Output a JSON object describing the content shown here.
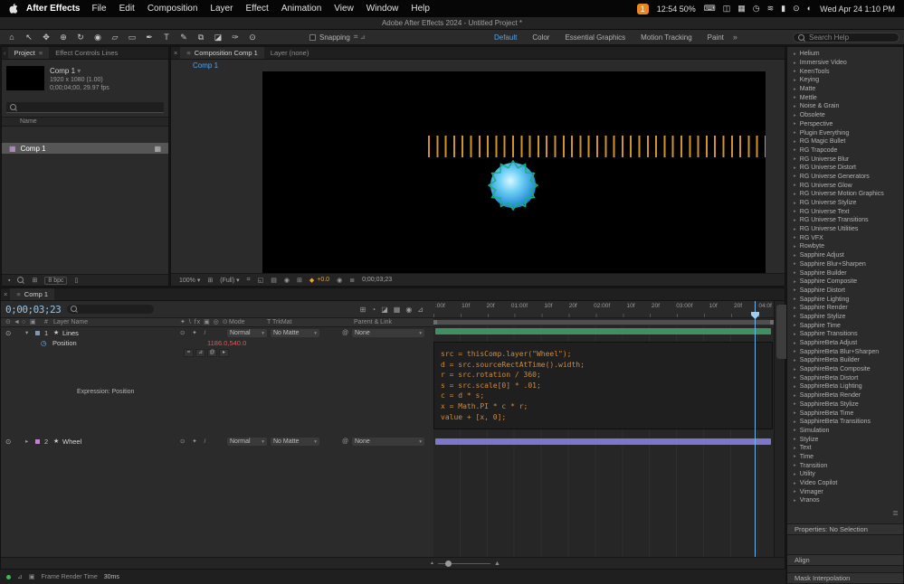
{
  "icons": {
    "menu": "≡",
    "hamburger": "≣",
    "close": "×",
    "chevron_left": "‹",
    "chevron_down": "▾",
    "chevron_exp": "▸",
    "twirl_open": "▾",
    "star": "★",
    "eye": "⊙",
    "audio": "◄",
    "solo": "○",
    "lock": "▣",
    "stopwatch": "◷",
    "pickwhip": "@",
    "comp": "▦",
    "grid": "⊞",
    "safe_margins": "⌗",
    "mask": "◱",
    "ruler": "▤",
    "camera": "◉",
    "diamond": "◆",
    "more": "»",
    "equals": "=",
    "graph": "⊿",
    "trash": "▯",
    "folder": "▪",
    "gear": "⚙"
  },
  "menubar": {
    "app_name": "After Effects",
    "menus": [
      "File",
      "Edit",
      "Composition",
      "Layer",
      "Effect",
      "Animation",
      "View",
      "Window",
      "Help"
    ],
    "notification_badge": "1",
    "battery_status": "12:54 50%",
    "status_icons": [
      {
        "name": "keyboard-icon",
        "glyph": "⌨"
      },
      {
        "name": "display-icon",
        "glyph": "◫"
      },
      {
        "name": "grid-icon",
        "glyph": "▦"
      },
      {
        "name": "clock-icon",
        "glyph": "◷"
      },
      {
        "name": "wifi-icon",
        "glyph": "≋"
      },
      {
        "name": "battery-icon",
        "glyph": "▮"
      },
      {
        "name": "spotlight-icon",
        "glyph": "⊙"
      },
      {
        "name": "control-center-icon",
        "glyph": "◐"
      }
    ],
    "clock": "Wed Apr 24 1:10 PM"
  },
  "titlebar": {
    "title": "Adobe After Effects 2024 - Untitled Project *"
  },
  "toolbar": {
    "tools": [
      {
        "name": "home-icon",
        "glyph": "⌂"
      },
      {
        "name": "selection-tool-icon",
        "glyph": "↖"
      },
      {
        "name": "hand-tool-icon",
        "glyph": "✥"
      },
      {
        "name": "zoom-tool-icon",
        "glyph": "⊕"
      },
      {
        "name": "orbit-camera-tool-icon",
        "glyph": "↻"
      },
      {
        "name": "camera-tool-icon",
        "glyph": "◉"
      },
      {
        "name": "pan-behind-tool-icon",
        "glyph": "▱"
      },
      {
        "name": "shape-tool-icon",
        "glyph": "▭"
      },
      {
        "name": "pen-tool-icon",
        "glyph": "✒"
      },
      {
        "name": "type-tool-icon",
        "glyph": "T"
      },
      {
        "name": "brush-tool-icon",
        "glyph": "✎"
      },
      {
        "name": "clone-stamp-tool-icon",
        "glyph": "⧉"
      },
      {
        "name": "eraser-tool-icon",
        "glyph": "◪"
      },
      {
        "name": "roto-brush-tool-icon",
        "glyph": "✑"
      },
      {
        "name": "puppet-pin-tool-icon",
        "glyph": "⊙"
      }
    ],
    "snapping_label": "Snapping",
    "snap_glyphs": "⌗⊿",
    "workspaces": [
      "Default",
      "Color",
      "Essential Graphics",
      "Motion Tracking",
      "Paint"
    ],
    "search_placeholder": "Search Help"
  },
  "project": {
    "tabs": [
      "Project",
      "Effect Controls Lines"
    ],
    "comp_name": "Comp 1",
    "comp_size": "1920 x 1080 (1.00)",
    "comp_duration": "0;00;04;00, 29.97 fps",
    "name_column": "Name",
    "items": [
      {
        "label": "Comp 1"
      }
    ],
    "bit_depth": "8 bpc"
  },
  "comp": {
    "tabs": [
      "Composition Comp 1",
      "Layer (none)"
    ],
    "breadcrumb": "Comp 1",
    "zoom": "100%",
    "resolution": "(Full)",
    "exposure": "+0.0",
    "timecode": "0;00;03;23"
  },
  "timeline": {
    "tab": "Comp 1",
    "timecode": "0;00;03;23",
    "toggles": [
      {
        "name": "comp-mini-flowchart-icon",
        "glyph": "⊞"
      },
      {
        "name": "draft-3d-icon",
        "glyph": "◔"
      },
      {
        "name": "shy-icon",
        "glyph": "◪"
      },
      {
        "name": "frame-blending-icon",
        "glyph": "▦"
      },
      {
        "name": "motion-blur-icon",
        "glyph": "◉"
      },
      {
        "name": "graph-editor-icon",
        "glyph": "⊿"
      }
    ],
    "columns": {
      "number": "#",
      "layer_name": "Layer Name",
      "mode": "Mode",
      "trkmat": "T TrkMat",
      "parent": "Parent & Link"
    },
    "switch_icons": "✦ \\ fx ▣ ◎ ⊙",
    "layers": [
      {
        "index": "1",
        "name": "Lines",
        "switches": "⊙ ✦ /",
        "mode": "Normal",
        "trkmat": "No Matte",
        "parent": "None"
      },
      {
        "index": "2",
        "name": "Wheel",
        "switches": "⊙ ✦ /",
        "mode": "Normal",
        "trkmat": "No Matte",
        "parent": "None"
      }
    ],
    "position_label": "Position",
    "position_value": "1186.0,540.0",
    "expression_label": "Expression: Position",
    "expression_code": [
      "src = thisComp.layer(\"Wheel\");",
      "d = src.sourceRectAtTime().width;",
      "r = src.rotation / 360;",
      "s = src.scale[0] * .01;",
      "c = d * s;",
      "x = Math.PI * c * r;",
      "value + [x, 0];"
    ],
    "ruler_labels": [
      ":00f",
      "10f",
      "20f",
      "01:00f",
      "10f",
      "20f",
      "02:00f",
      "10f",
      "20f",
      "03:00f",
      "10f",
      "20f",
      "04:0f"
    ]
  },
  "effects": {
    "categories": [
      "Helium",
      "Immersive Video",
      "KeenTools",
      "Keying",
      "Matte",
      "Mettle",
      "Noise & Grain",
      "Obsolete",
      "Perspective",
      "Plugin Everything",
      "RG Magic Bullet",
      "RG Trapcode",
      "RG Universe Blur",
      "RG Universe Distort",
      "RG Universe Generators",
      "RG Universe Glow",
      "RG Universe Motion Graphics",
      "RG Universe Stylize",
      "RG Universe Text",
      "RG Universe Transitions",
      "RG Universe Utilities",
      "RG VFX",
      "Rowbyte",
      "Sapphire Adjust",
      "Sapphire Blur+Sharpen",
      "Sapphire Builder",
      "Sapphire Composite",
      "Sapphire Distort",
      "Sapphire Lighting",
      "Sapphire Render",
      "Sapphire Stylize",
      "Sapphire Time",
      "Sapphire Transitions",
      "SapphireBeta Adjust",
      "SapphireBeta Blur+Sharpen",
      "SapphireBeta Builder",
      "SapphireBeta Composite",
      "SapphireBeta Distort",
      "SapphireBeta Lighting",
      "SapphireBeta Render",
      "SapphireBeta Stylize",
      "SapphireBeta Time",
      "SapphireBeta Transitions",
      "Simulation",
      "Stylize",
      "Text",
      "Time",
      "Transition",
      "Utility",
      "Video Copilot",
      "Vimager",
      "Vranos"
    ]
  },
  "panels": {
    "properties": "Properties: No Selection",
    "align": "Align",
    "mask": "Mask Interpolation"
  },
  "statusbar": {
    "label": "Frame Render Time",
    "value": "30ms"
  },
  "colors": {
    "accent": "#4fa3f2",
    "tick_orange": "#cf9428",
    "expression_text": "#d08b3e",
    "layer_bar_green": "#3f8f63",
    "layer_bar_purple": "#7d77cc",
    "value_red": "#e05555",
    "timecode_blue": "#8fc7f2"
  }
}
